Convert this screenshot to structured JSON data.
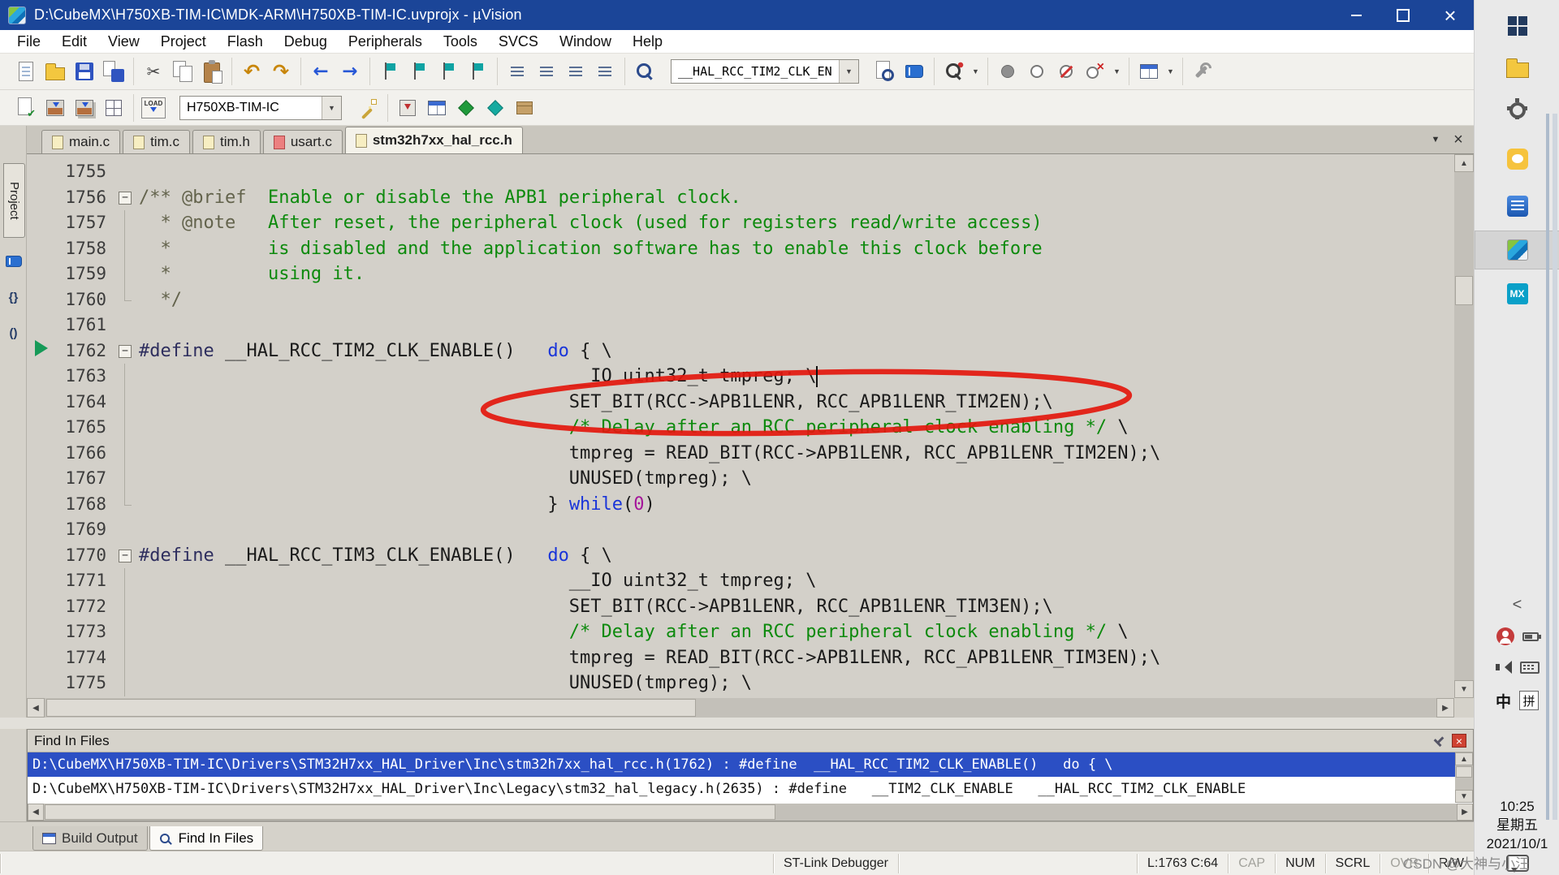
{
  "window": {
    "title": "D:\\CubeMX\\H750XB-TIM-IC\\MDK-ARM\\H750XB-TIM-IC.uvprojx - µVision"
  },
  "colors": {
    "titlebar": "#1b4598",
    "selection": "#2b4fc4",
    "annotation": "#e3170d",
    "comment_green": "#0d8a0d",
    "keyword_blue": "#1a35d9"
  },
  "menu": [
    "File",
    "Edit",
    "View",
    "Project",
    "Flash",
    "Debug",
    "Peripherals",
    "Tools",
    "SVCS",
    "Window",
    "Help"
  ],
  "toolbar_main": {
    "find_combo_value": "__HAL_RCC_TIM2_CLK_EN",
    "left_groups": [
      [
        {
          "n": "new-file-icon",
          "k": "page"
        },
        {
          "n": "open-file-icon",
          "k": "folder"
        },
        {
          "n": "save-icon",
          "k": "floppy"
        },
        {
          "n": "save-all-icon",
          "k": "floppy-all"
        }
      ],
      [
        {
          "n": "cut-icon",
          "k": "scissors",
          "g": "✂"
        },
        {
          "n": "copy-icon",
          "k": "copy"
        },
        {
          "n": "paste-icon",
          "k": "paste"
        }
      ],
      [
        {
          "n": "undo-icon",
          "k": "glyph",
          "g": "↶"
        },
        {
          "n": "redo-icon",
          "k": "glyph",
          "g": "↷"
        }
      ],
      [
        {
          "n": "navigate-back-icon",
          "k": "glyph-blue",
          "g": "←"
        },
        {
          "n": "navigate-forward-icon",
          "k": "glyph-blue",
          "g": "→"
        }
      ],
      [
        {
          "n": "bookmark-toggle-icon",
          "k": "flag"
        },
        {
          "n": "bookmark-prev-icon",
          "k": "flag"
        },
        {
          "n": "bookmark-next-icon",
          "k": "flag"
        },
        {
          "n": "bookmark-clear-icon",
          "k": "flag"
        }
      ],
      [
        {
          "n": "indent-left-icon",
          "k": "bars"
        },
        {
          "n": "indent-right-icon",
          "k": "bars"
        },
        {
          "n": "comment-icon",
          "k": "bars"
        },
        {
          "n": "uncomment-icon",
          "k": "bars"
        }
      ],
      [
        {
          "n": "find-in-files-icon",
          "k": "mag"
        }
      ]
    ],
    "right_groups": [
      [
        {
          "n": "incremental-find-icon",
          "k": "page-mag"
        },
        {
          "n": "find-icon",
          "k": "book"
        }
      ],
      [
        {
          "n": "search-scope-icon",
          "k": "mag-q"
        },
        {
          "n": "search-scope-caret",
          "k": "caret",
          "g": "▼"
        }
      ],
      [
        {
          "n": "breakpoint-toggle-icon",
          "k": "circle-fill"
        },
        {
          "n": "breakpoint-enable-icon",
          "k": "circle-hollow"
        },
        {
          "n": "breakpoint-disable-icon",
          "k": "circle-slash"
        },
        {
          "n": "breakpoint-kill-icon",
          "k": "circle-x"
        },
        {
          "n": "breakpoint-caret",
          "k": "caret",
          "g": "▼"
        }
      ],
      [
        {
          "n": "debug-windows-icon",
          "k": "window-grid"
        },
        {
          "n": "debug-windows-caret",
          "k": "caret",
          "g": "▼"
        }
      ],
      [
        {
          "n": "configure-wrench-icon",
          "k": "wrench"
        }
      ]
    ]
  },
  "toolbar_build": {
    "target_combo_value": "H750XB-TIM-IC",
    "load_label": "LOAD",
    "left_groups": [
      [
        {
          "n": "translate-icon",
          "k": "page-check"
        },
        {
          "n": "build-icon",
          "k": "build"
        },
        {
          "n": "rebuild-icon",
          "k": "build2"
        },
        {
          "n": "batch-build-icon",
          "k": "grid"
        }
      ],
      [
        {
          "n": "download-icon",
          "k": "load",
          "t": "LOAD"
        }
      ]
    ],
    "right_groups": [
      [
        {
          "n": "target-options-icon",
          "k": "wand"
        }
      ],
      [
        {
          "n": "flash-erase-icon",
          "k": "box-arrow"
        },
        {
          "n": "debug-session-icon",
          "k": "window-grid"
        },
        {
          "n": "manage-rte-icon",
          "k": "diamond-green"
        },
        {
          "n": "manage-devices-icon",
          "k": "diamond-teal"
        },
        {
          "n": "pack-installer-icon",
          "k": "box-brown"
        }
      ]
    ]
  },
  "side": {
    "project_label": "Project"
  },
  "editor_tabs": [
    {
      "label": "main.c",
      "active": false,
      "variant": "normal"
    },
    {
      "label": "tim.c",
      "active": false,
      "variant": "normal"
    },
    {
      "label": "tim.h",
      "active": false,
      "variant": "normal"
    },
    {
      "label": "usart.c",
      "active": false,
      "variant": "red"
    },
    {
      "label": "stm32h7xx_hal_rcc.h",
      "active": true,
      "variant": "normal"
    }
  ],
  "editor": {
    "lines": [
      {
        "n": 1755,
        "f": null,
        "s": []
      },
      {
        "n": 1756,
        "f": "s",
        "s": [
          [
            "dox",
            "/** "
          ],
          [
            "dox",
            "@brief"
          ],
          [
            "com",
            "  Enable or disable the APB1 peripheral clock."
          ]
        ]
      },
      {
        "n": 1757,
        "f": "m",
        "s": [
          [
            "dox",
            "  * "
          ],
          [
            "dox",
            "@note"
          ],
          [
            "com",
            "   After reset, the peripheral clock (used for registers read/write access)"
          ]
        ]
      },
      {
        "n": 1758,
        "f": "m",
        "s": [
          [
            "dox",
            "  *"
          ],
          [
            "com",
            "         is disabled and the application software has to enable this clock before"
          ]
        ]
      },
      {
        "n": 1759,
        "f": "m",
        "s": [
          [
            "dox",
            "  *"
          ],
          [
            "com",
            "         using it."
          ]
        ]
      },
      {
        "n": 1760,
        "f": "e",
        "s": [
          [
            "dox",
            "  */"
          ]
        ]
      },
      {
        "n": 1761,
        "f": null,
        "s": []
      },
      {
        "n": 1762,
        "f": "s",
        "s": [
          [
            "pp",
            "#define "
          ],
          [
            "txt",
            "__HAL_RCC_TIM2_CLK_ENABLE()   "
          ],
          [
            "kw",
            "do"
          ],
          [
            "txt",
            " { \\"
          ]
        ]
      },
      {
        "n": 1763,
        "f": "m",
        "s": [
          [
            "txt",
            "                                        __IO uint32_t tmpreg; \\"
          ]
        ]
      },
      {
        "n": 1764,
        "f": "m",
        "s": [
          [
            "txt",
            "                                        SET_BIT(RCC->APB1LENR, RCC_APB1LENR_TIM2EN);\\"
          ]
        ]
      },
      {
        "n": 1765,
        "f": "m",
        "s": [
          [
            "txt",
            "                                        "
          ],
          [
            "com",
            "/* Delay after an RCC peripheral clock enabling */"
          ],
          [
            "txt",
            " \\"
          ]
        ]
      },
      {
        "n": 1766,
        "f": "m",
        "s": [
          [
            "txt",
            "                                        tmpreg = READ_BIT(RCC->APB1LENR, RCC_APB1LENR_TIM2EN);\\"
          ]
        ]
      },
      {
        "n": 1767,
        "f": "m",
        "s": [
          [
            "txt",
            "                                        UNUSED(tmpreg); \\"
          ]
        ]
      },
      {
        "n": 1768,
        "f": "e",
        "s": [
          [
            "txt",
            "                                      } "
          ],
          [
            "kw",
            "while"
          ],
          [
            "txt",
            "("
          ],
          [
            "num",
            "0"
          ],
          [
            "txt",
            ")"
          ]
        ]
      },
      {
        "n": 1769,
        "f": null,
        "s": []
      },
      {
        "n": 1770,
        "f": "s",
        "s": [
          [
            "pp",
            "#define "
          ],
          [
            "txt",
            "__HAL_RCC_TIM3_CLK_ENABLE()   "
          ],
          [
            "kw",
            "do"
          ],
          [
            "txt",
            " { \\"
          ]
        ]
      },
      {
        "n": 1771,
        "f": "m",
        "s": [
          [
            "txt",
            "                                        __IO uint32_t tmpreg; \\"
          ]
        ]
      },
      {
        "n": 1772,
        "f": "m",
        "s": [
          [
            "txt",
            "                                        SET_BIT(RCC->APB1LENR, RCC_APB1LENR_TIM3EN);\\"
          ]
        ]
      },
      {
        "n": 1773,
        "f": "m",
        "s": [
          [
            "txt",
            "                                        "
          ],
          [
            "com",
            "/* Delay after an RCC peripheral clock enabling */"
          ],
          [
            "txt",
            " \\"
          ]
        ]
      },
      {
        "n": 1774,
        "f": "m",
        "s": [
          [
            "txt",
            "                                        tmpreg = READ_BIT(RCC->APB1LENR, RCC_APB1LENR_TIM3EN);\\"
          ]
        ]
      },
      {
        "n": 1775,
        "f": "m",
        "s": [
          [
            "txt",
            "                                        UNUSED(tmpreg); \\"
          ]
        ]
      }
    ]
  },
  "find_panel": {
    "title": "Find In Files",
    "results": [
      {
        "text": "D:\\CubeMX\\H750XB-TIM-IC\\Drivers\\STM32H7xx_HAL_Driver\\Inc\\stm32h7xx_hal_rcc.h(1762) : #define  __HAL_RCC_TIM2_CLK_ENABLE()   do { \\",
        "selected": true
      },
      {
        "text": "D:\\CubeMX\\H750XB-TIM-IC\\Drivers\\STM32H7xx_HAL_Driver\\Inc\\Legacy\\stm32_hal_legacy.h(2635) : #define   __TIM2_CLK_ENABLE   __HAL_RCC_TIM2_CLK_ENABLE",
        "selected": false
      }
    ]
  },
  "bottom_tabs": [
    {
      "label": "Build Output",
      "icon": "bo",
      "icon_name": "build-output-icon",
      "active": false
    },
    {
      "label": "Find In Files",
      "icon": "fif",
      "icon_name": "find-in-files-tab-icon",
      "active": true
    }
  ],
  "status": {
    "debugger": "ST-Link Debugger",
    "cursor": "L:1763 C:64",
    "flags": [
      {
        "label": "CAP",
        "dim": true
      },
      {
        "label": "NUM",
        "dim": false
      },
      {
        "label": "SCRL",
        "dim": false
      },
      {
        "label": "OVR",
        "dim": true
      },
      {
        "label": "R/W",
        "dim": false
      }
    ]
  },
  "taskbar": {
    "time": "10:25",
    "weekday": "星期五",
    "date": "2021/10/1",
    "ime_lang": "中",
    "ime_mode": "拼",
    "cubemx_label": "MX"
  },
  "watermark": "CSDN @大神与小汪"
}
